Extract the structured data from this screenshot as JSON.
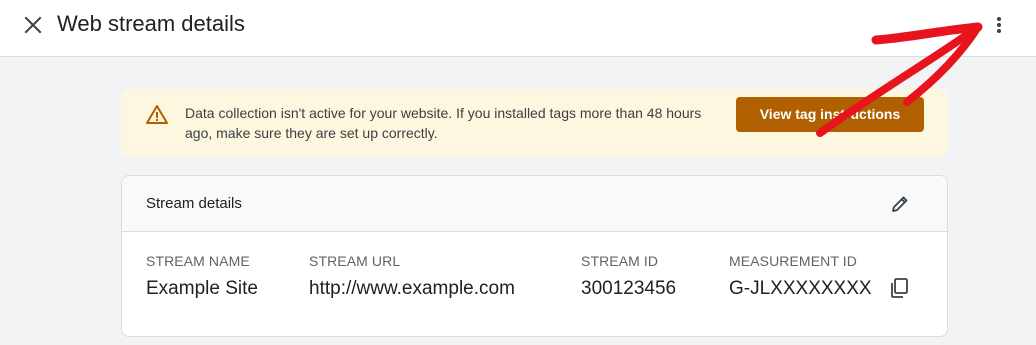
{
  "header": {
    "title": "Web stream details",
    "close_icon": "close-icon",
    "more_icon": "more-vert-icon"
  },
  "banner": {
    "icon": "warning-icon",
    "message": "Data collection isn't active for your website. If you installed tags more than 48 hours ago, make sure they are set up correctly.",
    "button_label": "View tag instructions",
    "colors": {
      "background": "#fef7e0",
      "button": "#b06000",
      "icon": "#b06000"
    }
  },
  "stream_details": {
    "title": "Stream details",
    "edit_icon": "pencil-icon",
    "fields": [
      {
        "label": "STREAM NAME",
        "value": "Example Site"
      },
      {
        "label": "STREAM URL",
        "value": "http://www.example.com"
      },
      {
        "label": "STREAM ID",
        "value": "300123456"
      },
      {
        "label": "MEASUREMENT ID",
        "value": "G-JLXXXXXXXX"
      }
    ],
    "copy_icon": "copy-icon"
  },
  "annotation": {
    "type": "hand-drawn-arrow",
    "color": "#e8141d",
    "points_to": "more-vert-icon"
  }
}
